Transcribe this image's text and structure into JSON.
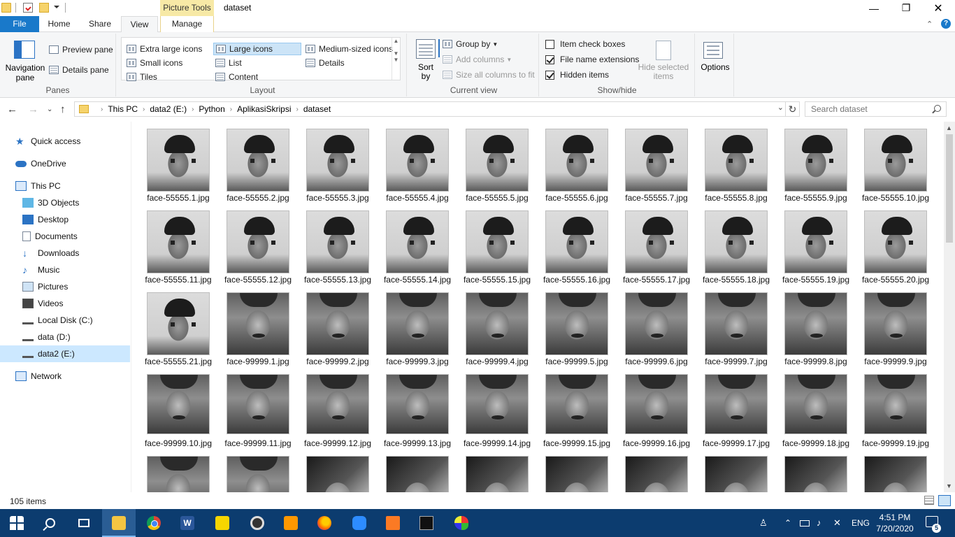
{
  "window": {
    "title": "dataset",
    "context_tab_header": "Picture Tools",
    "controls": {
      "minimize": "—",
      "maximize": "❐",
      "close": "✕"
    }
  },
  "ribbon_tabs": [
    {
      "label": "File"
    },
    {
      "label": "Home"
    },
    {
      "label": "Share"
    },
    {
      "label": "View"
    },
    {
      "label": "Manage"
    }
  ],
  "ribbon": {
    "panes": {
      "label": "Panes",
      "navigation_pane": "Navigation pane",
      "preview_pane": "Preview pane",
      "details_pane": "Details pane"
    },
    "layout": {
      "label": "Layout",
      "options": {
        "extra_large": "Extra large icons",
        "large": "Large icons",
        "medium": "Medium-sized icons",
        "small": "Small icons",
        "list": "List",
        "details": "Details",
        "tiles": "Tiles",
        "content": "Content"
      },
      "selected": "Large icons"
    },
    "current_view": {
      "label": "Current view",
      "sort_by": "Sort by",
      "group_by": "Group by",
      "add_columns": "Add columns",
      "size_columns": "Size all columns to fit"
    },
    "show_hide": {
      "label": "Show/hide",
      "item_check_boxes": {
        "label": "Item check boxes",
        "checked": false
      },
      "file_name_extensions": {
        "label": "File name extensions",
        "checked": true
      },
      "hidden_items": {
        "label": "Hidden items",
        "checked": true
      },
      "hide_selected": "Hide selected items"
    },
    "options": {
      "label": "Options"
    }
  },
  "address": {
    "breadcrumbs": [
      "This PC",
      "data2 (E:)",
      "Python",
      "AplikasiSkripsi",
      "dataset"
    ],
    "search_placeholder": "Search dataset"
  },
  "nav_pane": {
    "items": [
      {
        "label": "Quick access",
        "icon": "star-icon"
      },
      {
        "label": "OneDrive",
        "icon": "cloud-icon"
      },
      {
        "label": "This PC",
        "icon": "computer-icon"
      },
      {
        "label": "3D Objects",
        "icon": "cube-icon"
      },
      {
        "label": "Desktop",
        "icon": "desktop-icon"
      },
      {
        "label": "Documents",
        "icon": "document-icon"
      },
      {
        "label": "Downloads",
        "icon": "download-icon"
      },
      {
        "label": "Music",
        "icon": "music-icon"
      },
      {
        "label": "Pictures",
        "icon": "pictures-icon"
      },
      {
        "label": "Videos",
        "icon": "video-icon"
      },
      {
        "label": "Local Disk (C:)",
        "icon": "drive-icon"
      },
      {
        "label": "data (D:)",
        "icon": "drive-icon"
      },
      {
        "label": "data2 (E:)",
        "icon": "drive-icon"
      },
      {
        "label": "Network",
        "icon": "network-icon"
      }
    ],
    "selected": "data2 (E:)"
  },
  "files": [
    "face-55555.1.jpg",
    "face-55555.2.jpg",
    "face-55555.3.jpg",
    "face-55555.4.jpg",
    "face-55555.5.jpg",
    "face-55555.6.jpg",
    "face-55555.7.jpg",
    "face-55555.8.jpg",
    "face-55555.9.jpg",
    "face-55555.10.jpg",
    "face-55555.11.jpg",
    "face-55555.12.jpg",
    "face-55555.13.jpg",
    "face-55555.14.jpg",
    "face-55555.15.jpg",
    "face-55555.16.jpg",
    "face-55555.17.jpg",
    "face-55555.18.jpg",
    "face-55555.19.jpg",
    "face-55555.20.jpg",
    "face-55555.21.jpg",
    "face-99999.1.jpg",
    "face-99999.2.jpg",
    "face-99999.3.jpg",
    "face-99999.4.jpg",
    "face-99999.5.jpg",
    "face-99999.6.jpg",
    "face-99999.7.jpg",
    "face-99999.8.jpg",
    "face-99999.9.jpg",
    "face-99999.10.jpg",
    "face-99999.11.jpg",
    "face-99999.12.jpg",
    "face-99999.13.jpg",
    "face-99999.14.jpg",
    "face-99999.15.jpg",
    "face-99999.16.jpg",
    "face-99999.17.jpg",
    "face-99999.18.jpg",
    "face-99999.19.jpg"
  ],
  "status": {
    "item_count": "105 items"
  },
  "taskbar": {
    "apps": [
      "start",
      "search",
      "task-view",
      "file-explorer",
      "chrome",
      "word",
      "sticky-notes",
      "media-player",
      "sublime-text",
      "firefox",
      "zoom",
      "xampp",
      "command-prompt",
      "paint"
    ],
    "language": "ENG",
    "time": "4:51 PM",
    "date": "7/20/2020",
    "notification_count": "5"
  },
  "colors": {
    "accent": "#1979ca",
    "taskbar": "#0c3c6f",
    "selection": "#cce8ff",
    "context_tab": "#f7e9a6"
  }
}
